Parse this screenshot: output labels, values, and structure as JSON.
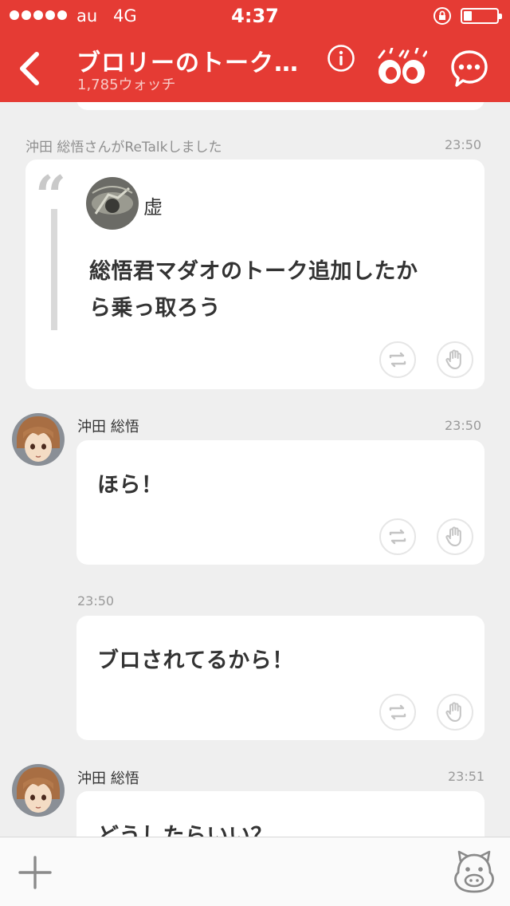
{
  "status_bar": {
    "carrier": "au",
    "network": "4G",
    "time": "4:37",
    "battery_level": 0.25
  },
  "header": {
    "title": "ブロリーのトーク…",
    "watch_count": "1,785ウォッチ",
    "icons": [
      "back-icon",
      "info-icon",
      "watch-eyes-icon",
      "chat-bubble-icon"
    ]
  },
  "feed": {
    "retalk": {
      "notice": "沖田 総悟さんがReTalkしました",
      "time": "23:50",
      "quote_mark": "“",
      "quoted_author": "虚",
      "quoted_text": [
        "総悟君マダオのトーク追加したか",
        "ら乗っ取ろう"
      ]
    },
    "message_1": {
      "author": "沖田 総悟",
      "time": "23:50",
      "text": "ほら！"
    },
    "message_2": {
      "time": "23:50",
      "text": "ブロされてるから！"
    },
    "message_3": {
      "author": "沖田 総悟",
      "time": "23:51",
      "text": "どうしたらいい？"
    }
  },
  "bottom_bar": {
    "icons": [
      "plus-icon",
      "mascot-icon"
    ]
  },
  "colors": {
    "brand": "#e53b34",
    "background": "#efefef"
  }
}
